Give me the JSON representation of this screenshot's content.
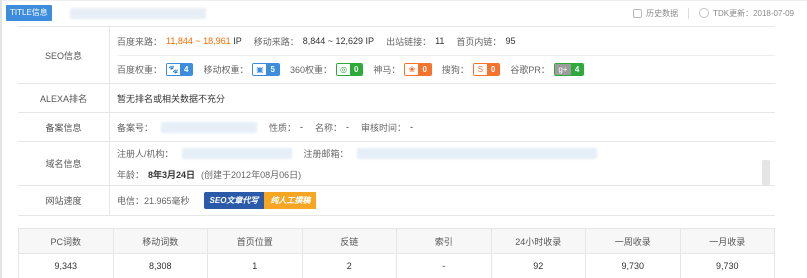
{
  "header": {
    "title_tag": "TITLE信息",
    "history": "历史数据",
    "tdk_update": "TDK更新：2018-07-09"
  },
  "seo": {
    "label": "SEO信息",
    "baidu_traffic": {
      "label": "百度来路：",
      "value": "11,844 ~ 18,961",
      "unit": "IP"
    },
    "mobile_traffic": {
      "label": "移动来路：",
      "value": "8,844 ~ 12,629",
      "unit": "IP"
    },
    "out_links": {
      "label": "出站链接：",
      "value": "11"
    },
    "home_links": {
      "label": "首页内链：",
      "value": "95"
    },
    "weights": [
      {
        "label": "百度权重：",
        "icon": "paw-icon",
        "value": "4",
        "color": "#3c8dde"
      },
      {
        "label": "移动权重：",
        "icon": "mobile-paw-icon",
        "value": "5",
        "color": "#3c8dde"
      },
      {
        "label": "360权重：",
        "icon": "360-icon",
        "value": "0",
        "color": "#2eaa3b"
      },
      {
        "label": "神马：",
        "icon": "shenma-icon",
        "value": "0",
        "color": "#f6722d"
      },
      {
        "label": "搜狗：",
        "icon": "sogou-icon",
        "value": "0",
        "color": "#f6722d"
      },
      {
        "label": "谷歌PR：",
        "icon": "google-plus-icon",
        "value": "4",
        "color": "#2eaa3b"
      }
    ]
  },
  "alexa": {
    "label": "ALEXA排名",
    "text": "暂无排名或相关数据不充分"
  },
  "icp": {
    "label": "备案信息",
    "number_label": "备案号：",
    "type_label": "性质：",
    "type_value": "-",
    "name_label": "名称：",
    "name_value": "-",
    "audit_label": "审核时间：",
    "audit_value": "-"
  },
  "domain": {
    "label": "域名信息",
    "registrant_label": "注册人/机构：",
    "email_label": "注册邮箱：",
    "age_label": "年龄：",
    "age_value": "8年3月24日",
    "created": "(创建于2012年08月06日)"
  },
  "speed": {
    "label": "网站速度",
    "telecom": "电信：21.965毫秒",
    "ad_left": "SEO文章代写",
    "ad_right": "纯人工撰稿"
  },
  "stats": {
    "headers": [
      "PC词数",
      "移动词数",
      "首页位置",
      "反链",
      "索引",
      "24小时收录",
      "一周收录",
      "一月收录"
    ],
    "values": [
      "9,343",
      "8,308",
      "1",
      "2",
      "-",
      "92",
      "9,730",
      "9,730"
    ]
  }
}
